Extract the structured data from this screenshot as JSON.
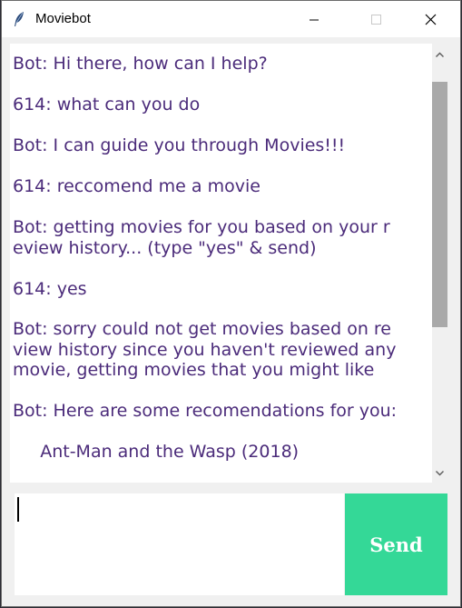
{
  "window": {
    "title": "Moviebot",
    "icon": "feather-icon",
    "controls": [
      "minimize-icon",
      "maximize-icon",
      "close-icon"
    ]
  },
  "chat": {
    "messages": [
      "Bot: Hi there, how can I help?",
      "614: what can you do",
      "Bot: I can guide you through Movies!!!",
      "614: reccomend me a movie",
      "Bot: getting movies for you based on your r\neview history... (type \"yes\" & send)",
      "614: yes",
      "Bot: sorry could not get movies based on re\nview history since you haven't reviewed any\nmovie, getting movies that you might like",
      "Bot: Here are some recomendations for you:",
      "     Ant-Man and the Wasp (2018)"
    ],
    "text_color": "#4b2b7a"
  },
  "input": {
    "value": "",
    "placeholder": ""
  },
  "send": {
    "label": "Send",
    "color": "#34d897"
  }
}
